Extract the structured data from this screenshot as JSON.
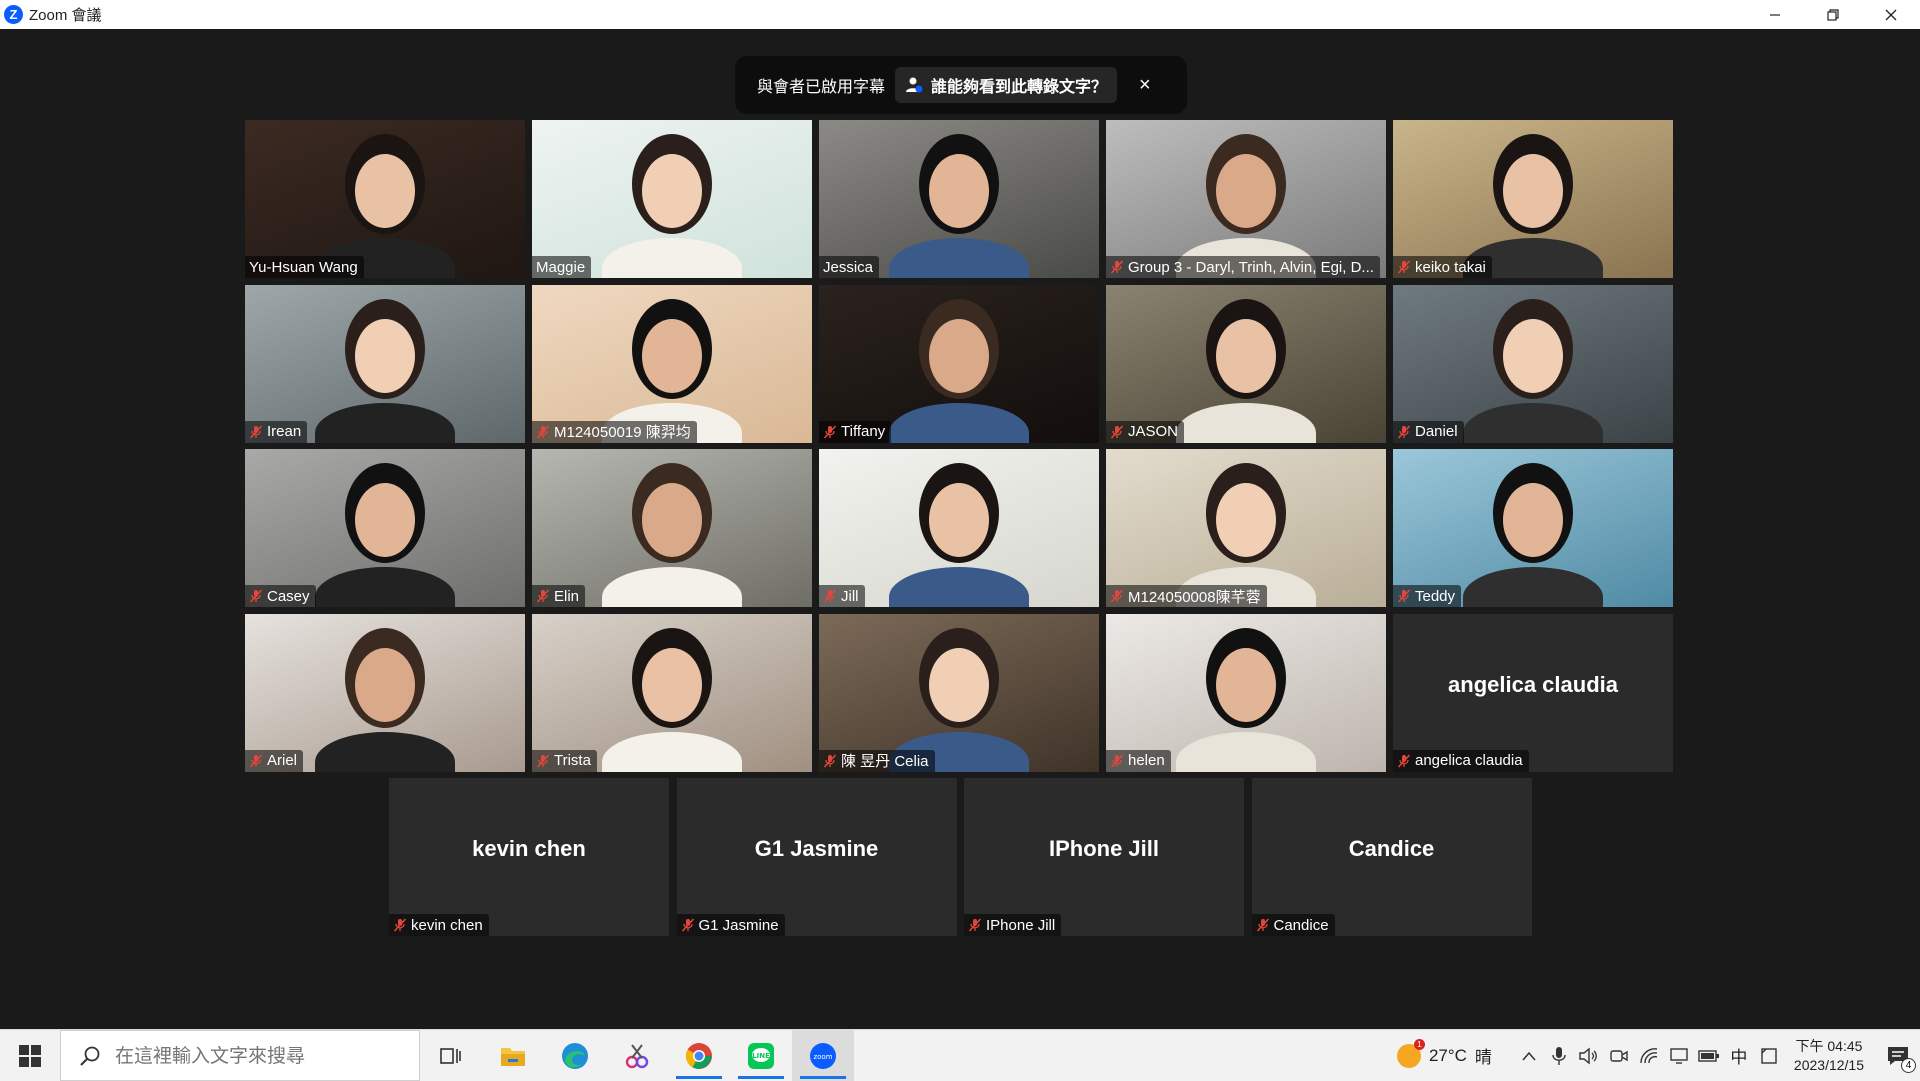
{
  "window": {
    "title": "Zoom 會議",
    "logo_letter": "Z"
  },
  "banner": {
    "caption_text": "與會者已啟用字幕",
    "who_label": "誰能夠看到此轉錄文字？",
    "close": "×"
  },
  "participants": [
    {
      "name": "Yu-Hsuan Wang",
      "muted": false,
      "active": false
    },
    {
      "name": "Maggie",
      "muted": false,
      "active": true
    },
    {
      "name": "Jessica",
      "muted": false,
      "active": false
    },
    {
      "name": "Group 3 - Daryl, Trinh, Alvin, Egi, D...",
      "muted": true,
      "active": false
    },
    {
      "name": "keiko takai",
      "muted": true,
      "active": false
    },
    {
      "name": "Irean",
      "muted": true,
      "active": false
    },
    {
      "name": "M124050019 陳羿均",
      "muted": true,
      "active": false
    },
    {
      "name": "Tiffany",
      "muted": true,
      "active": false
    },
    {
      "name": "JASON",
      "muted": true,
      "active": false
    },
    {
      "name": "Daniel",
      "muted": true,
      "active": false
    },
    {
      "name": "Casey",
      "muted": true,
      "active": false
    },
    {
      "name": "Elin",
      "muted": true,
      "active": false
    },
    {
      "name": "Jill",
      "muted": true,
      "active": false
    },
    {
      "name": "M124050008陳芊蓉",
      "muted": true,
      "active": false
    },
    {
      "name": "Teddy",
      "muted": true,
      "active": false
    },
    {
      "name": "Ariel",
      "muted": true,
      "active": false
    },
    {
      "name": "Trista",
      "muted": true,
      "active": false
    },
    {
      "name": "陳 昱丹 Celia",
      "muted": true,
      "active": false
    },
    {
      "name": "helen",
      "muted": true,
      "active": false
    },
    {
      "name": "angelica claudia",
      "muted": true,
      "active": false,
      "video_off": true
    },
    {
      "name": "kevin chen",
      "muted": true,
      "active": false,
      "video_off": true
    },
    {
      "name": "G1 Jasmine",
      "muted": true,
      "active": false,
      "video_off": true
    },
    {
      "name": "IPhone Jill",
      "muted": true,
      "active": false,
      "video_off": true
    },
    {
      "name": "Candice",
      "muted": true,
      "active": false,
      "video_off": true
    }
  ],
  "taskbar": {
    "search_placeholder": "在這裡輸入文字來搜尋",
    "apps": [
      "task-view-icon",
      "file-explorer-icon",
      "edge-icon",
      "snip-icon",
      "chrome-icon",
      "line-icon",
      "zoom-icon"
    ],
    "weather_temp": "27°C",
    "weather_cond": "晴",
    "weather_badge": "1",
    "ime": "中",
    "time_period": "下午 04:45",
    "date": "2023/12/15",
    "notification_count": "4"
  },
  "colors": {
    "background": "#1a1a1a",
    "active_speaker_border": "#dbf13a",
    "muted_red": "#e5463b",
    "zoom_blue": "#0b5cff"
  }
}
